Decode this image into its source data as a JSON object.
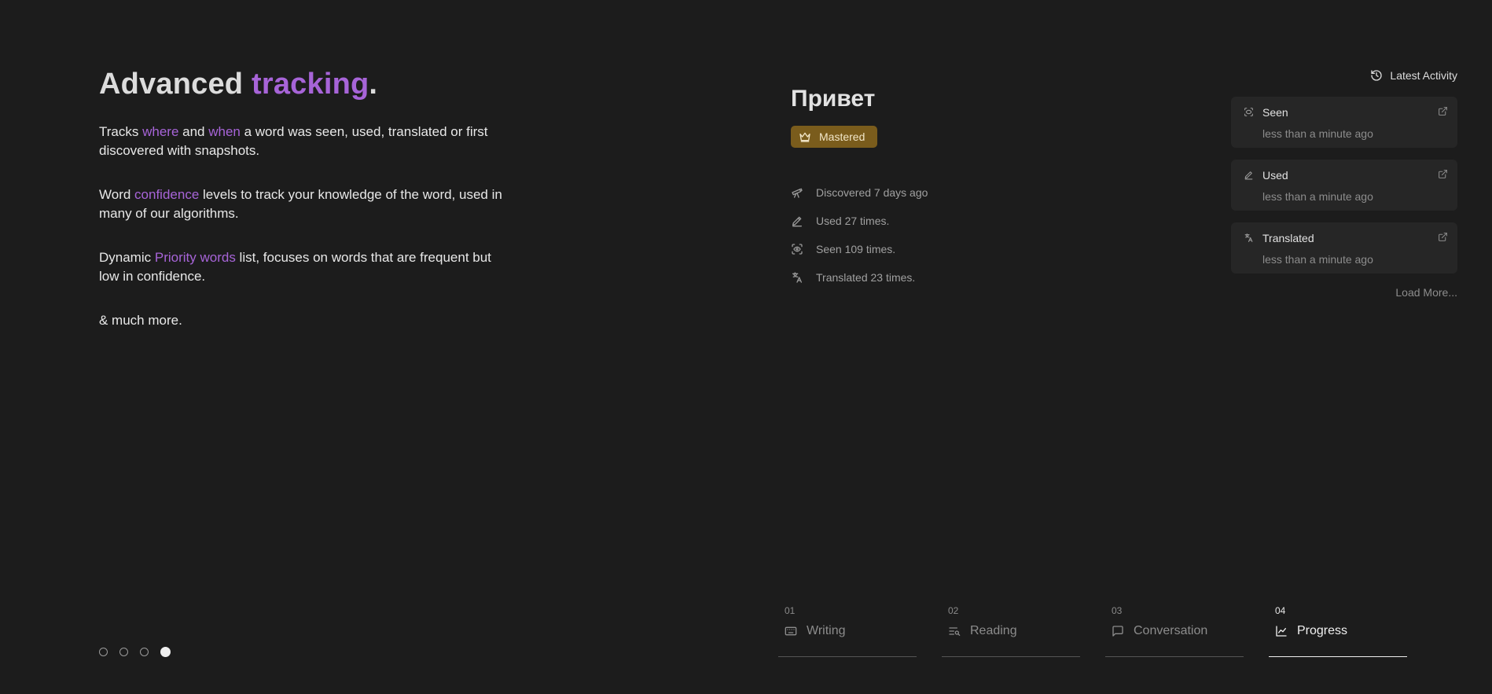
{
  "hero": {
    "title_a": "Advanced ",
    "title_accent": "tracking",
    "title_b": ".",
    "p1": {
      "a": "Tracks ",
      "b": "where",
      "c": " and ",
      "d": "when",
      "e": " a word was seen, used, translated or first discovered with snapshots."
    },
    "p2": {
      "a": "Word ",
      "b": "confidence",
      "c": " levels to track your knowledge of the word, used in many of our algorithms."
    },
    "p3": {
      "a": "Dynamic ",
      "b": "Priority words",
      "c": " list, focuses on words that are frequent but low in confidence."
    },
    "p4": "& much more."
  },
  "pager": {
    "total": 4,
    "active_index": 3
  },
  "word": {
    "title": "Привет",
    "badge": "Mastered",
    "stats": [
      {
        "icon": "telescope-icon",
        "text": "Discovered 7 days ago"
      },
      {
        "icon": "pencil-icon",
        "text": "Used 27 times."
      },
      {
        "icon": "scan-eye-icon",
        "text": "Seen 109 times."
      },
      {
        "icon": "translate-icon",
        "text": "Translated 23 times."
      }
    ]
  },
  "activity": {
    "heading": "Latest Activity",
    "items": [
      {
        "icon": "scan-eye-icon",
        "title": "Seen",
        "time": "less than a minute ago"
      },
      {
        "icon": "pencil-icon",
        "title": "Used",
        "time": "less than a minute ago"
      },
      {
        "icon": "translate-icon",
        "title": "Translated",
        "time": "less than a minute ago"
      }
    ],
    "load_more": "Load More..."
  },
  "tabs": [
    {
      "num": "01",
      "label": "Writing",
      "icon": "keyboard-icon"
    },
    {
      "num": "02",
      "label": "Reading",
      "icon": "reading-icon"
    },
    {
      "num": "03",
      "label": "Conversation",
      "icon": "chat-icon"
    },
    {
      "num": "04",
      "label": "Progress",
      "icon": "chart-icon",
      "active": true
    }
  ],
  "colors": {
    "accent": "#a764d8",
    "badge_bg": "#7a5c1c",
    "background": "#1c1c1c"
  }
}
